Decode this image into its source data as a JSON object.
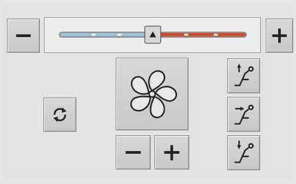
{
  "temperature": {
    "decrease_symbol": "minus-icon",
    "increase_symbol": "plus-icon",
    "level": 0.5,
    "cold_color": "#9bc3dc",
    "hot_color": "#d24a2e",
    "marker_icon": "triangle-up-icon"
  },
  "fan": {
    "icon": "fan-icon",
    "decrease_symbol": "minus-icon",
    "increase_symbol": "plus-icon"
  },
  "recirculation": {
    "icon": "recirculate-icon"
  },
  "air_distribution": {
    "items": [
      {
        "id": "upper",
        "icon": "seat-airflow-upper-icon"
      },
      {
        "id": "middle",
        "icon": "seat-airflow-middle-icon"
      },
      {
        "id": "lower",
        "icon": "seat-airflow-lower-icon"
      }
    ]
  }
}
